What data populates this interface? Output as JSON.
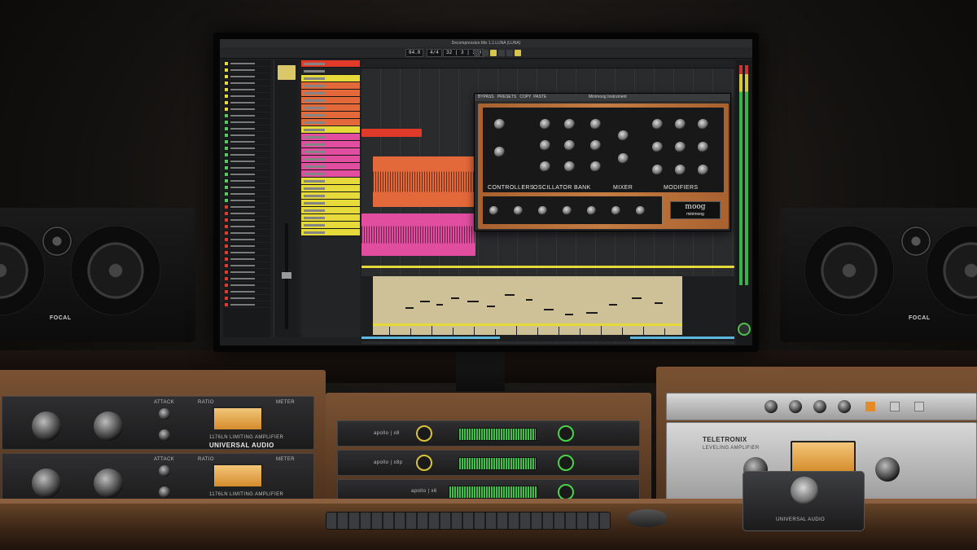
{
  "daw": {
    "window_title": "Decompression.Mix 1.1.LUNA (LUNA)",
    "transport": {
      "tempo": "84.0",
      "signature": "4/4",
      "position": "32 | 3 | 300"
    },
    "plugin_window": {
      "tabs": [
        "BYPASS",
        "PRESETS",
        "COPY",
        "PASTE"
      ],
      "title": "Minimoog Instrument",
      "sections": [
        "CONTROLLERS",
        "OSCILLATOR BANK",
        "MIXER",
        "MODIFIERS"
      ],
      "brand": "moog",
      "model": "minimoog"
    },
    "colors": {
      "accent_yellow": "#e6d93a",
      "clip_orange": "#e3693a",
      "clip_pink": "#e14ea0",
      "clip_red": "#df3a2a",
      "midi_bg": "#cfc197",
      "meter_green": "#38b348"
    }
  },
  "hardware": {
    "left_speaker_logo": "FOCAL",
    "right_speaker_logo": "FOCAL",
    "compressor_model": "1176LN LIMITING AMPLIFIER",
    "compressor_brand": "UNIVERSAL AUDIO",
    "compressor_labels": [
      "ATTACK",
      "RATIO",
      "METER"
    ],
    "interfaces": [
      "apollo | x8",
      "apollo | x8p",
      "apollo | x6"
    ],
    "teletronix": "TELETRONIX",
    "teletronix_sub": "LEVELING AMPLIFIER",
    "arrow_brand": "UNIVERSAL AUDIO"
  }
}
